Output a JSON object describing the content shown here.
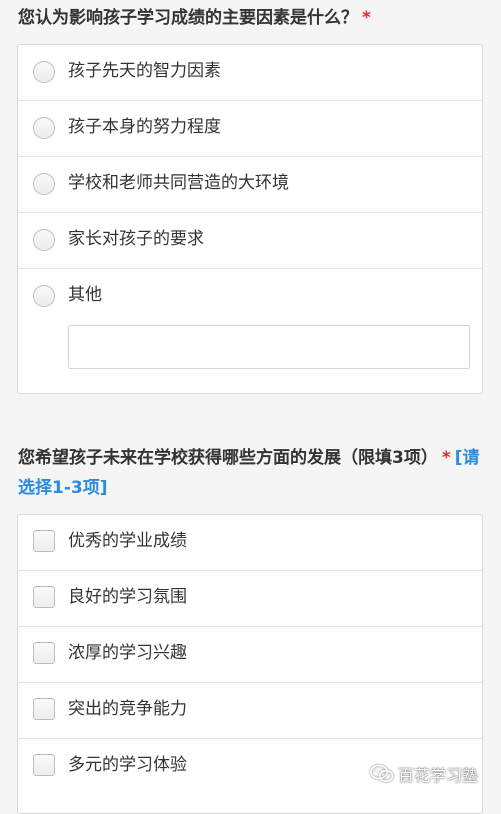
{
  "q1": {
    "title": "您认为影响孩子学习成绩的主要因素是什么？",
    "required_mark": "*",
    "options": [
      "孩子先天的智力因素",
      "孩子本身的努力程度",
      "学校和老师共同营造的大环境",
      "家长对孩子的要求",
      "其他"
    ],
    "other_input_value": ""
  },
  "q2": {
    "title": "您希望孩子未来在学校获得哪些方面的发展（限填3项）",
    "required_mark": "*",
    "hint": "[请选择1-3项]",
    "options": [
      "优秀的学业成绩",
      "良好的学习氛围",
      "浓厚的学习兴趣",
      "突出的竞争能力",
      "多元的学习体验"
    ]
  },
  "watermark": {
    "text": "百花学习塾",
    "icon": "wechat-icon"
  },
  "colors": {
    "required": "#e22b2b",
    "hint": "#2a8be0",
    "border": "#d9d9d9",
    "background": "#f5f5f5"
  }
}
